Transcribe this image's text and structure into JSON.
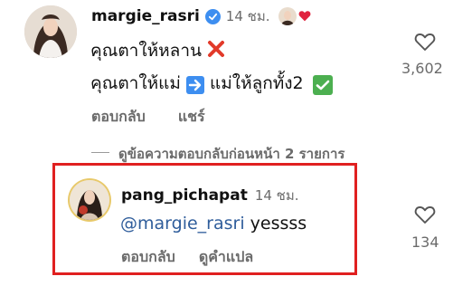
{
  "main_comment": {
    "username": "margie_rasri",
    "time": "14 ชม.",
    "line1": "คุณตาให้หลาน",
    "line2_part1": "คุณตาให้แม่",
    "line2_part2": "แม่ให้ลูกทั้ง2",
    "reply_label": "ตอบกลับ",
    "share_label": "แชร์",
    "like_count": "3,602"
  },
  "view_previous_replies": "ดูข้อความตอบกลับก่อนหน้า 2 รายการ",
  "reply": {
    "username": "pang_pichapat",
    "time": "14 ชม.",
    "mention": "@margie_rasri",
    "text": "yessss",
    "reply_label": "ตอบกลับ",
    "translate_label": "ดูคำแปล",
    "like_count": "134"
  },
  "colors": {
    "highlight_border": "#e02020",
    "verified": "#3d8ef0",
    "mention": "#2f5d9b",
    "muted": "#6b6b6b"
  },
  "icons": [
    "verified-badge-icon",
    "red-cross-mark-icon",
    "right-arrow-icon",
    "check-mark-icon",
    "heart-icon",
    "red-heart-icon"
  ]
}
